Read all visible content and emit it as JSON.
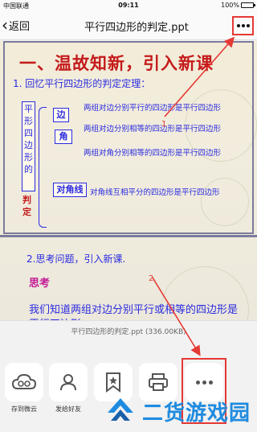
{
  "status_bar": {
    "carrier": "中国联通",
    "time": "09:11",
    "battery": "100%"
  },
  "nav": {
    "back_label": "返回",
    "title": "平行四边形的判定.ppt"
  },
  "slide": {
    "title": "一、温故知新，引入新课",
    "subtitle": "1. 回忆平行四边形的判定定理：",
    "vertical_label_blue": [
      "平",
      "形",
      "四",
      "边",
      "形",
      "的"
    ],
    "vertical_label_red": "判定",
    "categories": [
      {
        "label": "边",
        "rules": [
          "两组对边分别平行的四边形是平行四边形",
          "两组对边分别相等的四边形是平行四边形"
        ]
      },
      {
        "label": "角",
        "rules": [
          "两组对角分别相等的四边形是平行四边形"
        ]
      },
      {
        "label": "对角线",
        "rules": [
          "对角线互相平分的四边形是平行四边形"
        ]
      }
    ],
    "question_title": "2.思考问题，引入新课.",
    "think_label": "思考",
    "question_body": "我们知道两组对边分别平行或相等的四边形是平行四边形."
  },
  "annotations": {
    "step1": "1",
    "step2": "2",
    "color": "#e53935"
  },
  "sheet": {
    "file_info": "平行四边形的判定.ppt (336.00KB)",
    "actions": [
      {
        "label": "存到微云",
        "icon": "cloud-icon"
      },
      {
        "label": "发给好友",
        "icon": "person-icon"
      },
      {
        "label": "",
        "icon": "bookmark-star-icon"
      },
      {
        "label": "",
        "icon": "printer-icon"
      },
      {
        "label": "",
        "icon": "more-icon"
      }
    ]
  },
  "watermark": {
    "text": "二货游戏园"
  },
  "colors": {
    "slide_title": "#c41a1a",
    "slide_text": "#2b2be0",
    "think": "#c41a96",
    "watermark": "#1f8be0"
  }
}
